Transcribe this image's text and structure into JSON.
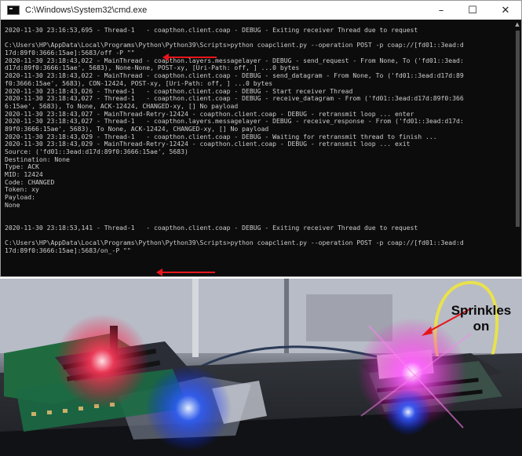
{
  "window": {
    "title": "C:\\Windows\\System32\\cmd.exe",
    "controls": {
      "minimize": "–",
      "maximize": "☐",
      "close": "✕"
    }
  },
  "console": {
    "lines": [
      "2020-11-30 23:16:53,695 - Thread-1   - coapthon.client.coap - DEBUG - Exiting receiver Thread due to request",
      "",
      "C:\\Users\\HP\\AppData\\Local\\Programs\\Python\\Python39\\Scripts>python coapclient.py --operation POST -p coap://[fd01::3ead:d",
      "17d:89f0:3666:15ae]:5683/off -P \"\"",
      "2020-11-30 23:18:43,022 - MainThread - coapthon.layers.messagelayer - DEBUG - send_request - From None, To ('fd01::3ead:",
      "d17d:89f0:3666:15ae', 5683), None-None, POST-xy, [Uri-Path: off, ] ...0 bytes",
      "2020-11-30 23:18:43,022 - MainThread - coapthon.client.coap - DEBUG - send_datagram - From None, To ('fd01::3ead:d17d:89",
      "f0:3666:15ae', 5683), CON-12424, POST-xy, [Uri-Path: off, ] ...0 bytes",
      "2020-11-30 23:18:43,026 - Thread-1   - coapthon.client.coap - DEBUG - Start receiver Thread",
      "2020-11-30 23:18:43,027 - Thread-1   - coapthon.client.coap - DEBUG - receive_datagram - From ('fd01::3ead:d17d:89f0:366",
      "6:15ae', 5683), To None, ACK-12424, CHANGED-xy, [] No payload",
      "2020-11-30 23:18:43,027 - MainThread-Retry-12424 - coapthon.client.coap - DEBUG - retransmit loop ... enter",
      "2020-11-30 23:18:43,027 - Thread-1   - coapthon.layers.messagelayer - DEBUG - receive_response - From ('fd01::3ead:d17d:",
      "89f0:3666:15ae', 5683), To None, ACK-12424, CHANGED-xy, [] No payload",
      "2020-11-30 23:18:43,029 - Thread-1   - coapthon.client.coap - DEBUG - Waiting for retransmit thread to finish ...",
      "2020-11-30 23:18:43,029 - MainThread-Retry-12424 - coapthon.client.coap - DEBUG - retransmit loop ... exit",
      "Source: ('fd01::3ead:d17d:89f0:3666:15ae', 5683)",
      "Destination: None",
      "Type: ACK",
      "MID: 12424",
      "Code: CHANGED",
      "Token: xy",
      "Payload:",
      "None",
      "",
      "",
      "2020-11-30 23:18:53,141 - Thread-1   - coapthon.client.coap - DEBUG - Exiting receiver Thread due to request",
      "",
      "C:\\Users\\HP\\AppData\\Local\\Programs\\Python\\Python39\\Scripts>python coapclient.py --operation POST -p coap://[fd01::3ead:d",
      "17d:89f0:3666:15ae]:5683/on_-P \"\""
    ]
  },
  "annotations": {
    "arrow_color": "#e8151b",
    "photo_label": "Sprinkles on"
  },
  "colors": {
    "console_bg": "#0c0c0c",
    "console_text": "#cccccc",
    "titlebar_bg": "#ffffff"
  }
}
